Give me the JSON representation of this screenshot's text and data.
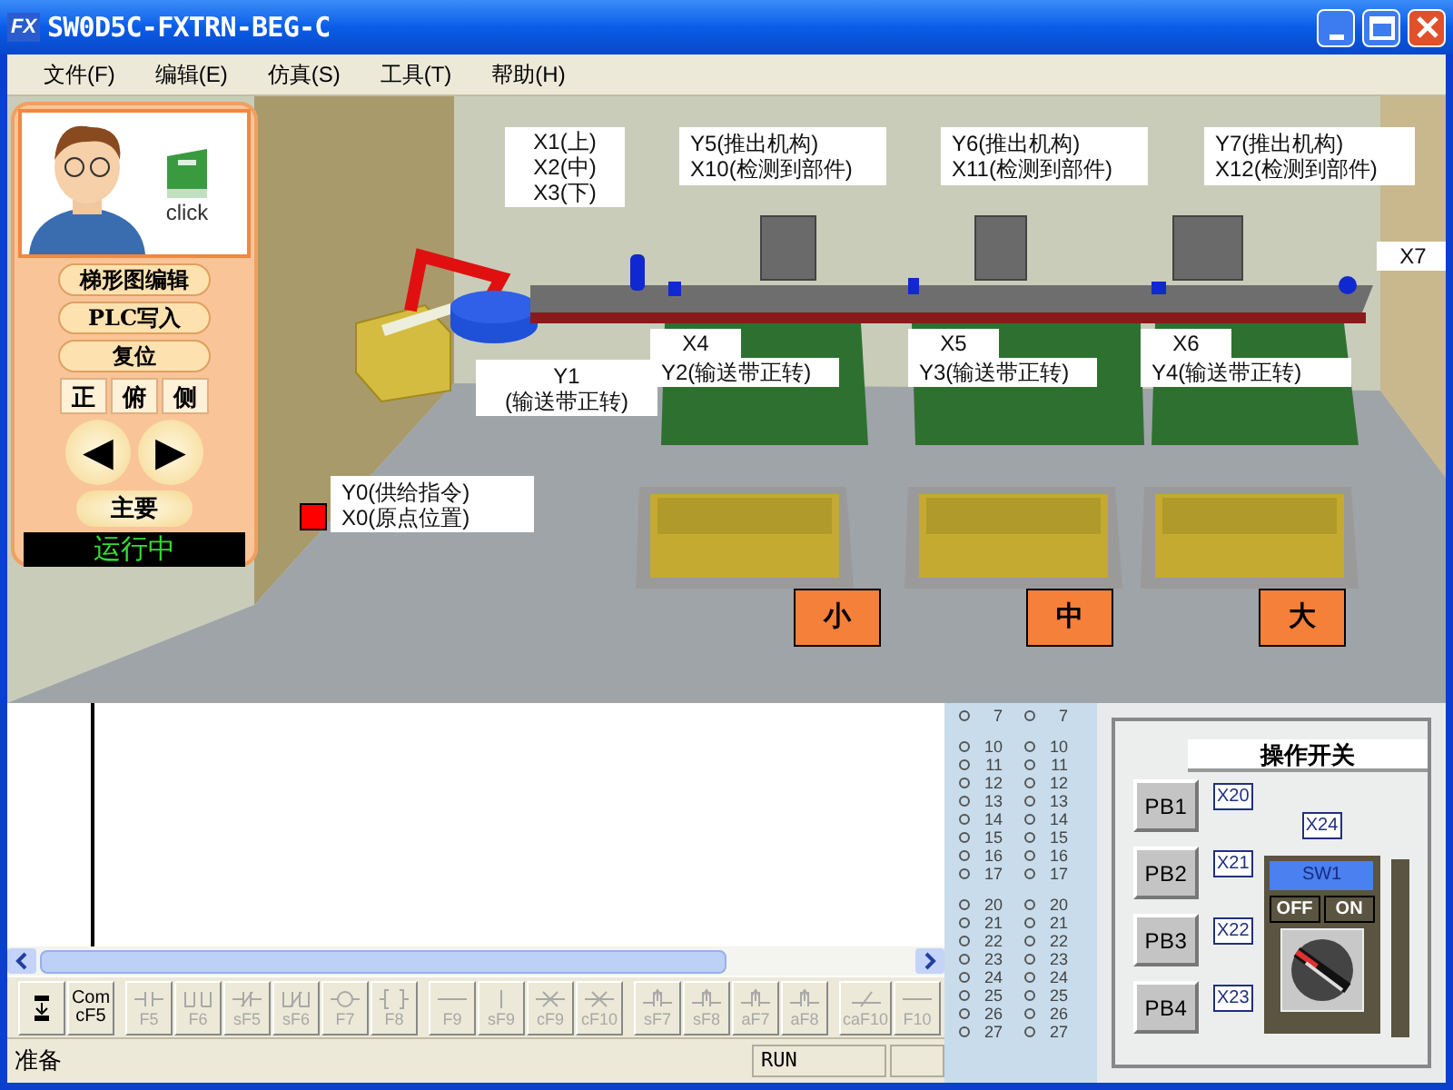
{
  "window": {
    "logo_text": "FX",
    "title": "SW0D5C-FXTRN-BEG-C"
  },
  "menu": [
    "文件(F)",
    "编辑(E)",
    "仿真(S)",
    "工具(T)",
    "帮助(H)"
  ],
  "side_panel": {
    "help_label": "click",
    "buttons": [
      "梯形图编辑",
      "PLC写入",
      "复位"
    ],
    "views": [
      {
        "label": "正",
        "selected": false
      },
      {
        "label": "俯",
        "selected": false
      },
      {
        "label": "侧",
        "selected": false
      }
    ],
    "nav": [
      "◀",
      "▶"
    ],
    "main_button": "主要",
    "status": "运行中"
  },
  "scene": {
    "labels": [
      {
        "lines": [
          "X1(上)",
          "X2(中)",
          "X3(下)"
        ]
      },
      {
        "lines": [
          "Y5(推出机构)",
          "X10(检测到部件)"
        ]
      },
      {
        "lines": [
          "Y6(推出机构)",
          "X11(检测到部件)"
        ]
      },
      {
        "lines": [
          "Y7(推出机构)",
          "X12(检测到部件)"
        ]
      },
      {
        "lines": [
          "X7"
        ]
      },
      {
        "lines": [
          "X4"
        ]
      },
      {
        "lines": [
          "X5"
        ]
      },
      {
        "lines": [
          "X6"
        ]
      },
      {
        "lines": [
          "Y1",
          "(输送带正转)"
        ]
      },
      {
        "lines": [
          "Y2(输送带正转)"
        ]
      },
      {
        "lines": [
          "Y3(输送带正转)"
        ]
      },
      {
        "lines": [
          "Y4(输送带正转)"
        ]
      },
      {
        "lines": [
          "Y0(供给指令)",
          "X0(原点位置)"
        ]
      }
    ],
    "bins": [
      "小",
      "中",
      "大"
    ]
  },
  "toolbar": [
    {
      "kind": "insert",
      "disabled": false
    },
    {
      "kind": "text",
      "lines": [
        "Com",
        "cF5"
      ],
      "disabled": false
    },
    {
      "kind": "contact",
      "lines": [
        "F5"
      ],
      "disabled": true
    },
    {
      "kind": "parallel",
      "lines": [
        "F6"
      ],
      "disabled": true
    },
    {
      "kind": "contact_b",
      "lines": [
        "sF5"
      ],
      "disabled": true
    },
    {
      "kind": "parallel_b",
      "lines": [
        "sF6"
      ],
      "disabled": true
    },
    {
      "kind": "coil",
      "lines": [
        "F7"
      ],
      "disabled": true
    },
    {
      "kind": "instr",
      "lines": [
        "F8"
      ],
      "disabled": true
    },
    {
      "kind": "hline",
      "lines": [
        "F9"
      ],
      "disabled": true
    },
    {
      "kind": "vline",
      "lines": [
        "sF9"
      ],
      "disabled": true
    },
    {
      "kind": "xdel",
      "lines": [
        "cF9"
      ],
      "disabled": true
    },
    {
      "kind": "xdel",
      "lines": [
        "cF10"
      ],
      "disabled": true
    },
    {
      "kind": "pulse",
      "lines": [
        "sF7"
      ],
      "disabled": true
    },
    {
      "kind": "pulse",
      "lines": [
        "sF8"
      ],
      "disabled": true
    },
    {
      "kind": "pulse",
      "lines": [
        "aF7"
      ],
      "disabled": true
    },
    {
      "kind": "pulse",
      "lines": [
        "aF8"
      ],
      "disabled": true
    },
    {
      "kind": "invert",
      "lines": [
        "caF10"
      ],
      "disabled": true
    },
    {
      "kind": "hline",
      "lines": [
        "F10"
      ],
      "disabled": true
    }
  ],
  "status_bar": {
    "message": "准备",
    "mode": "RUN"
  },
  "io_list": {
    "columns": [
      [
        "7",
        "10",
        "11",
        "12",
        "13",
        "14",
        "15",
        "16",
        "17",
        "20",
        "21",
        "22",
        "23",
        "24",
        "25",
        "26",
        "27"
      ],
      [
        "7",
        "10",
        "11",
        "12",
        "13",
        "14",
        "15",
        "16",
        "17",
        "20",
        "21",
        "22",
        "23",
        "24",
        "25",
        "26",
        "27"
      ]
    ]
  },
  "operation_panel": {
    "title": "操作开关",
    "pushbuttons": [
      {
        "label": "PB1",
        "input": "X20"
      },
      {
        "label": "PB2",
        "input": "X21"
      },
      {
        "label": "PB3",
        "input": "X22"
      },
      {
        "label": "PB4",
        "input": "X23"
      }
    ],
    "switch": {
      "input": "X24",
      "label": "SW1",
      "off": "OFF",
      "on": "ON"
    }
  }
}
